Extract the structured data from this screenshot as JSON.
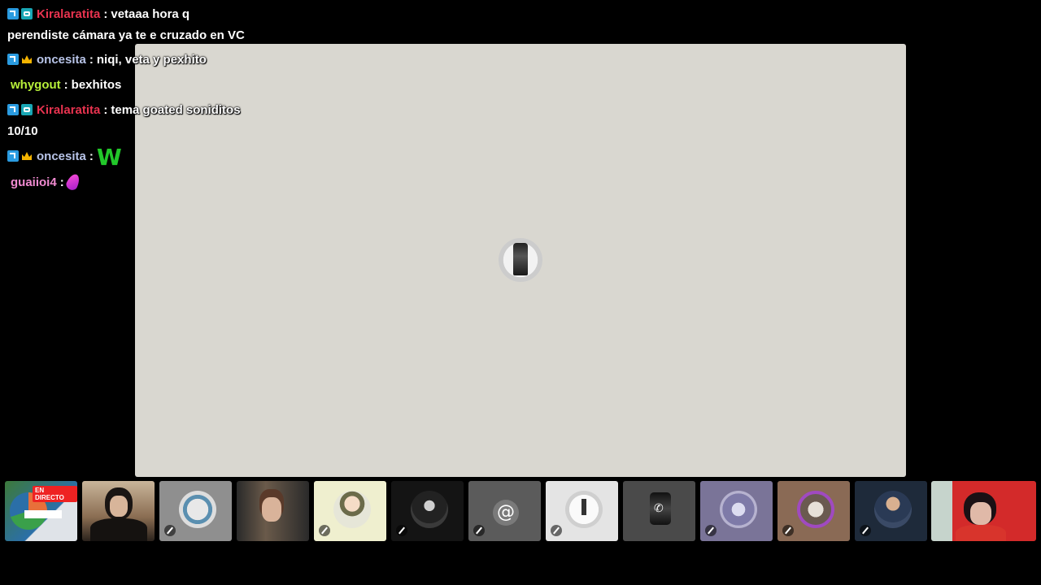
{
  "chat": {
    "messages": [
      {
        "user": "Kiralaratita",
        "user_color": "#e8334f",
        "badges": [
          "arrow-badge",
          "game-badge"
        ],
        "text": "vetaaa hora q"
      },
      {
        "continuation": "perendiste cámara ya te e cruzado en VC"
      },
      {
        "user": "oncesita",
        "user_color": "#b8c4e8",
        "badges": [
          "arrow-badge",
          "crown-badge"
        ],
        "text": "niqi, veta y pexhito"
      },
      {
        "user": "whygout",
        "user_color": "#b7f03a",
        "badges": [],
        "text": "bexhitos"
      },
      {
        "user": "Kiralaratita",
        "user_color": "#e8334f",
        "badges": [
          "arrow-badge",
          "game-badge"
        ],
        "text": "tema goated soniditos"
      },
      {
        "continuation": "10/10"
      },
      {
        "user": "oncesita",
        "user_color": "#b8c4e8",
        "badges": [
          "arrow-badge",
          "crown-badge"
        ],
        "emote": "W"
      },
      {
        "user": "guaiioi4",
        "user_color": "#f08ad0",
        "badges": [],
        "emote": "feather-emote"
      }
    ],
    "separator": ":"
  },
  "stage": {
    "background": "#d9d7d0",
    "avatar_icon": "statue-avatar"
  },
  "participants": {
    "live_label": "EN DIRECTO",
    "at_symbol": "@",
    "phone_symbol": "✆",
    "tiles": [
      {
        "name": "screen-share",
        "muted": false
      },
      {
        "name": "webcam-1",
        "muted": false
      },
      {
        "name": "avatar-monitor",
        "muted": true
      },
      {
        "name": "webcam-2",
        "muted": false
      },
      {
        "name": "avatar-officer",
        "muted": true
      },
      {
        "name": "avatar-dark",
        "muted": true
      },
      {
        "name": "avatar-at",
        "muted": true
      },
      {
        "name": "avatar-walker",
        "muted": true
      },
      {
        "name": "avatar-phone",
        "muted": false
      },
      {
        "name": "avatar-angel",
        "muted": true
      },
      {
        "name": "avatar-frame",
        "muted": true
      },
      {
        "name": "webcam-3",
        "muted": true
      },
      {
        "name": "webcam-4",
        "muted": false
      }
    ]
  }
}
